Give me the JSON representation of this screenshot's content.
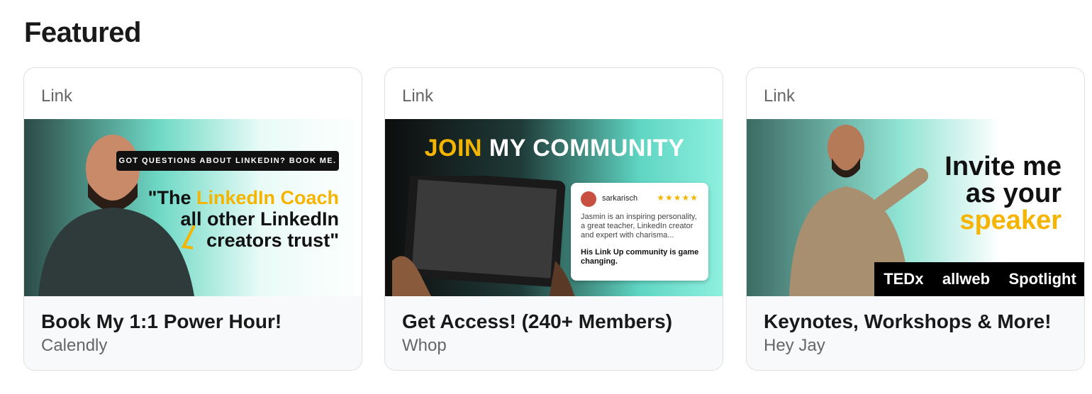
{
  "section": {
    "title": "Featured"
  },
  "cards": [
    {
      "type": "Link",
      "title": "Book My 1:1 Power Hour!",
      "subtitle": "Calendly",
      "media": {
        "banner": "GOT QUESTIONS ABOUT LINKEDIN? BOOK ME.",
        "quote_pre": "\"The ",
        "quote_highlight": "LinkedIn Coach",
        "quote_post": "all other LinkedIn creators trust\""
      }
    },
    {
      "type": "Link",
      "title": "Get Access! (240+ Members)",
      "subtitle": "Whop",
      "media": {
        "headline_a": "JOIN",
        "headline_b": "MY COMMUNITY",
        "review_name": "sarkarisch",
        "review_stars": "★★★★★",
        "review_text": "Jasmin is an inspiring personality, a great teacher, LinkedIn creator and expert with charisma...",
        "review_bold": "His Link Up community is game changing."
      }
    },
    {
      "type": "Link",
      "title": "Keynotes, Workshops & More!",
      "subtitle": "Hey Jay",
      "media": {
        "line1": "Invite me",
        "line2": "as your",
        "line3": "speaker",
        "logo1": "TEDx",
        "logo2": "allweb",
        "logo3": "Spotlight"
      }
    }
  ],
  "colors": {
    "accent": "#f5b400",
    "teal": "#6fd9c6"
  }
}
